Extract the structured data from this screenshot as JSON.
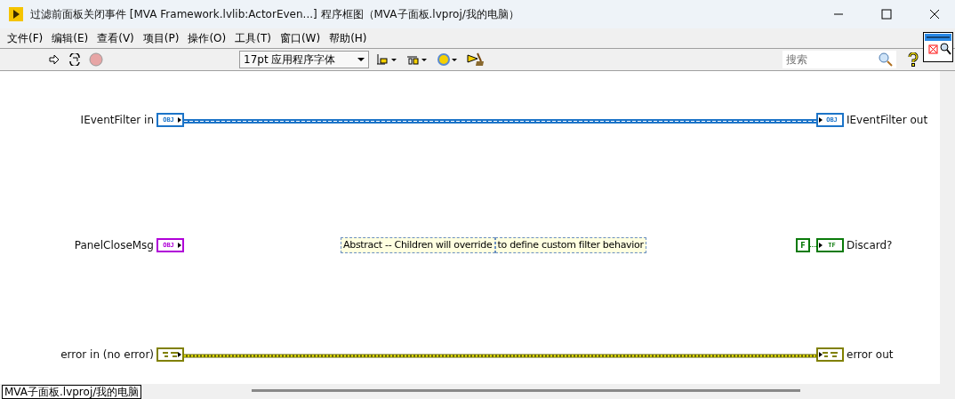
{
  "window": {
    "title": "过滤前面板关闭事件 [MVA Framework.lvlib:ActorEven...] 程序框图（MVA子面板.lvproj/我的电脑）"
  },
  "menu": [
    "文件(F)",
    "编辑(E)",
    "查看(V)",
    "项目(P)",
    "操作(O)",
    "工具(T)",
    "窗口(W)",
    "帮助(H)"
  ],
  "toolbar": {
    "font": "17pt 应用程序字体",
    "search": {
      "placeholder": "搜索"
    }
  },
  "diagram": {
    "terminals": [
      {
        "kind": "control",
        "label": "IEventFilter in",
        "type": "OBJ",
        "color": "#1c74c8"
      },
      {
        "kind": "indicator",
        "label": "IEventFilter out",
        "type": "OBJ",
        "color": "#1c74c8"
      },
      {
        "kind": "control",
        "label": "PanelCloseMsg",
        "type": "OBJ",
        "color": "#b000d8"
      },
      {
        "kind": "constant",
        "label": "F",
        "color": "#0a7a0a"
      },
      {
        "kind": "indicator",
        "label": "Discard?",
        "type": "TF",
        "color": "#0a7a0a"
      },
      {
        "kind": "control",
        "label": "error in (no error)",
        "color": "#808000"
      },
      {
        "kind": "indicator",
        "label": "error out",
        "color": "#808000"
      }
    ],
    "comments": [
      "Abstract -- Children will override",
      "to define custom filter behavior"
    ]
  },
  "status_bar": {
    "context": "MVA子面板.lvproj/我的电脑"
  }
}
